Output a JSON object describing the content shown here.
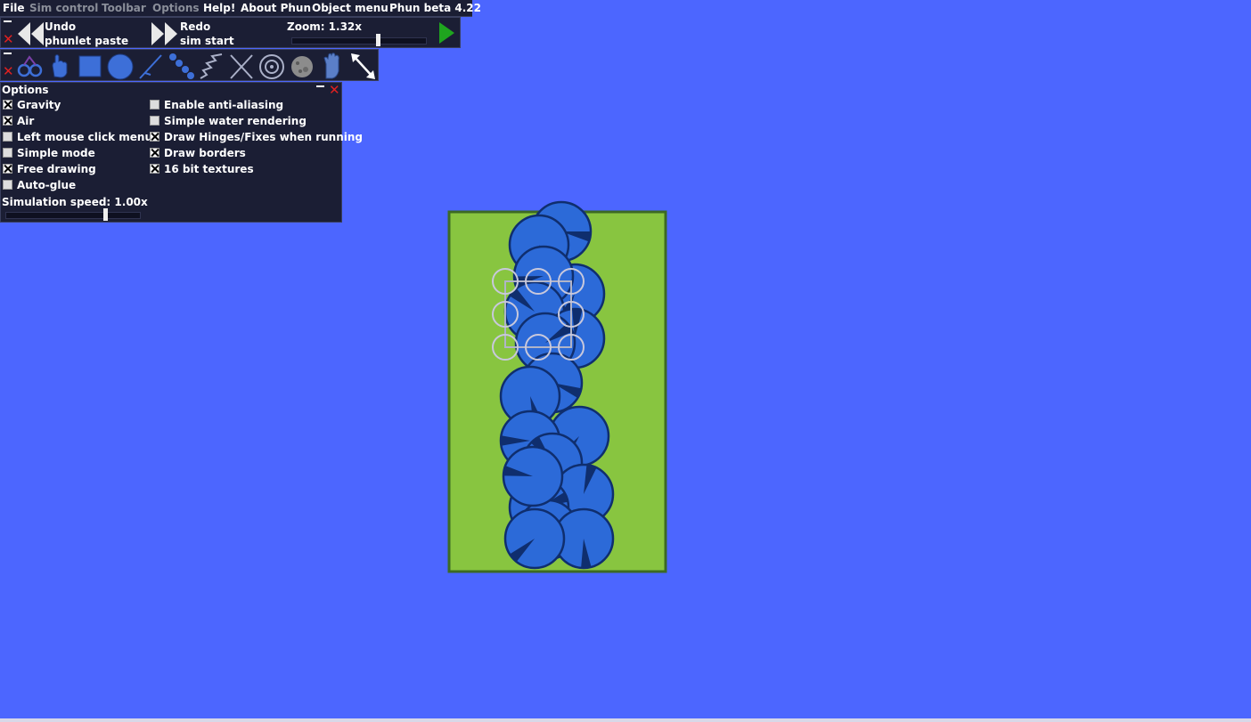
{
  "menubar": {
    "items": [
      {
        "label": "File",
        "enabled": true
      },
      {
        "label": "Sim control",
        "enabled": false
      },
      {
        "label": "Toolbar",
        "enabled": false
      },
      {
        "label": "Options",
        "enabled": false
      },
      {
        "label": "Help!",
        "enabled": true
      },
      {
        "label": "About Phun",
        "enabled": true
      },
      {
        "label": "Object menu",
        "enabled": true
      },
      {
        "label": "Phun beta 4.22",
        "enabled": true
      }
    ]
  },
  "undo_panel": {
    "undo_label": "Undo",
    "undo_detail": "phunlet paste",
    "redo_label": "Redo",
    "redo_detail": "sim start",
    "zoom_label": "Zoom: 1.32x",
    "zoom_value": 1.32,
    "zoom_slider_fraction": 0.65
  },
  "toolbar": {
    "tools": [
      "chain-tool-icon",
      "drag-hand-icon",
      "box-tool-icon",
      "circle-tool-icon",
      "brush-tool-icon",
      "chain-links-icon",
      "spring-tool-icon",
      "fixate-tool-icon",
      "hinge-tool-icon",
      "texture-tool-icon",
      "glove-tool-icon",
      "scale-tool-icon"
    ],
    "selected_tool": "scale-tool-icon"
  },
  "options": {
    "title": "Options",
    "left": [
      {
        "label": "Gravity",
        "checked": true
      },
      {
        "label": "Air",
        "checked": true
      },
      {
        "label": "Left mouse click menus",
        "checked": false
      },
      {
        "label": "Simple mode",
        "checked": false
      },
      {
        "label": "Free drawing",
        "checked": true
      },
      {
        "label": "Auto-glue",
        "checked": false
      }
    ],
    "right": [
      {
        "label": "Enable anti-aliasing",
        "checked": false
      },
      {
        "label": "Simple water rendering",
        "checked": false
      },
      {
        "label": "Draw Hinges/Fixes when running",
        "checked": true
      },
      {
        "label": "Draw borders",
        "checked": true
      },
      {
        "label": "16 bit textures",
        "checked": true
      }
    ],
    "sim_speed_label": "Simulation speed: 1.00x",
    "sim_speed_value": 1.0,
    "sim_speed_slider_fraction": 0.75
  },
  "colors": {
    "background": "#4c66ff",
    "panel": "#1b1e34",
    "container_fill": "#88c540",
    "container_border": "#3c6a24",
    "ball_fill": "#2c6ad8",
    "ball_border": "#0f2e6e",
    "close_red": "#e02020",
    "play_green": "#1fa51f"
  }
}
